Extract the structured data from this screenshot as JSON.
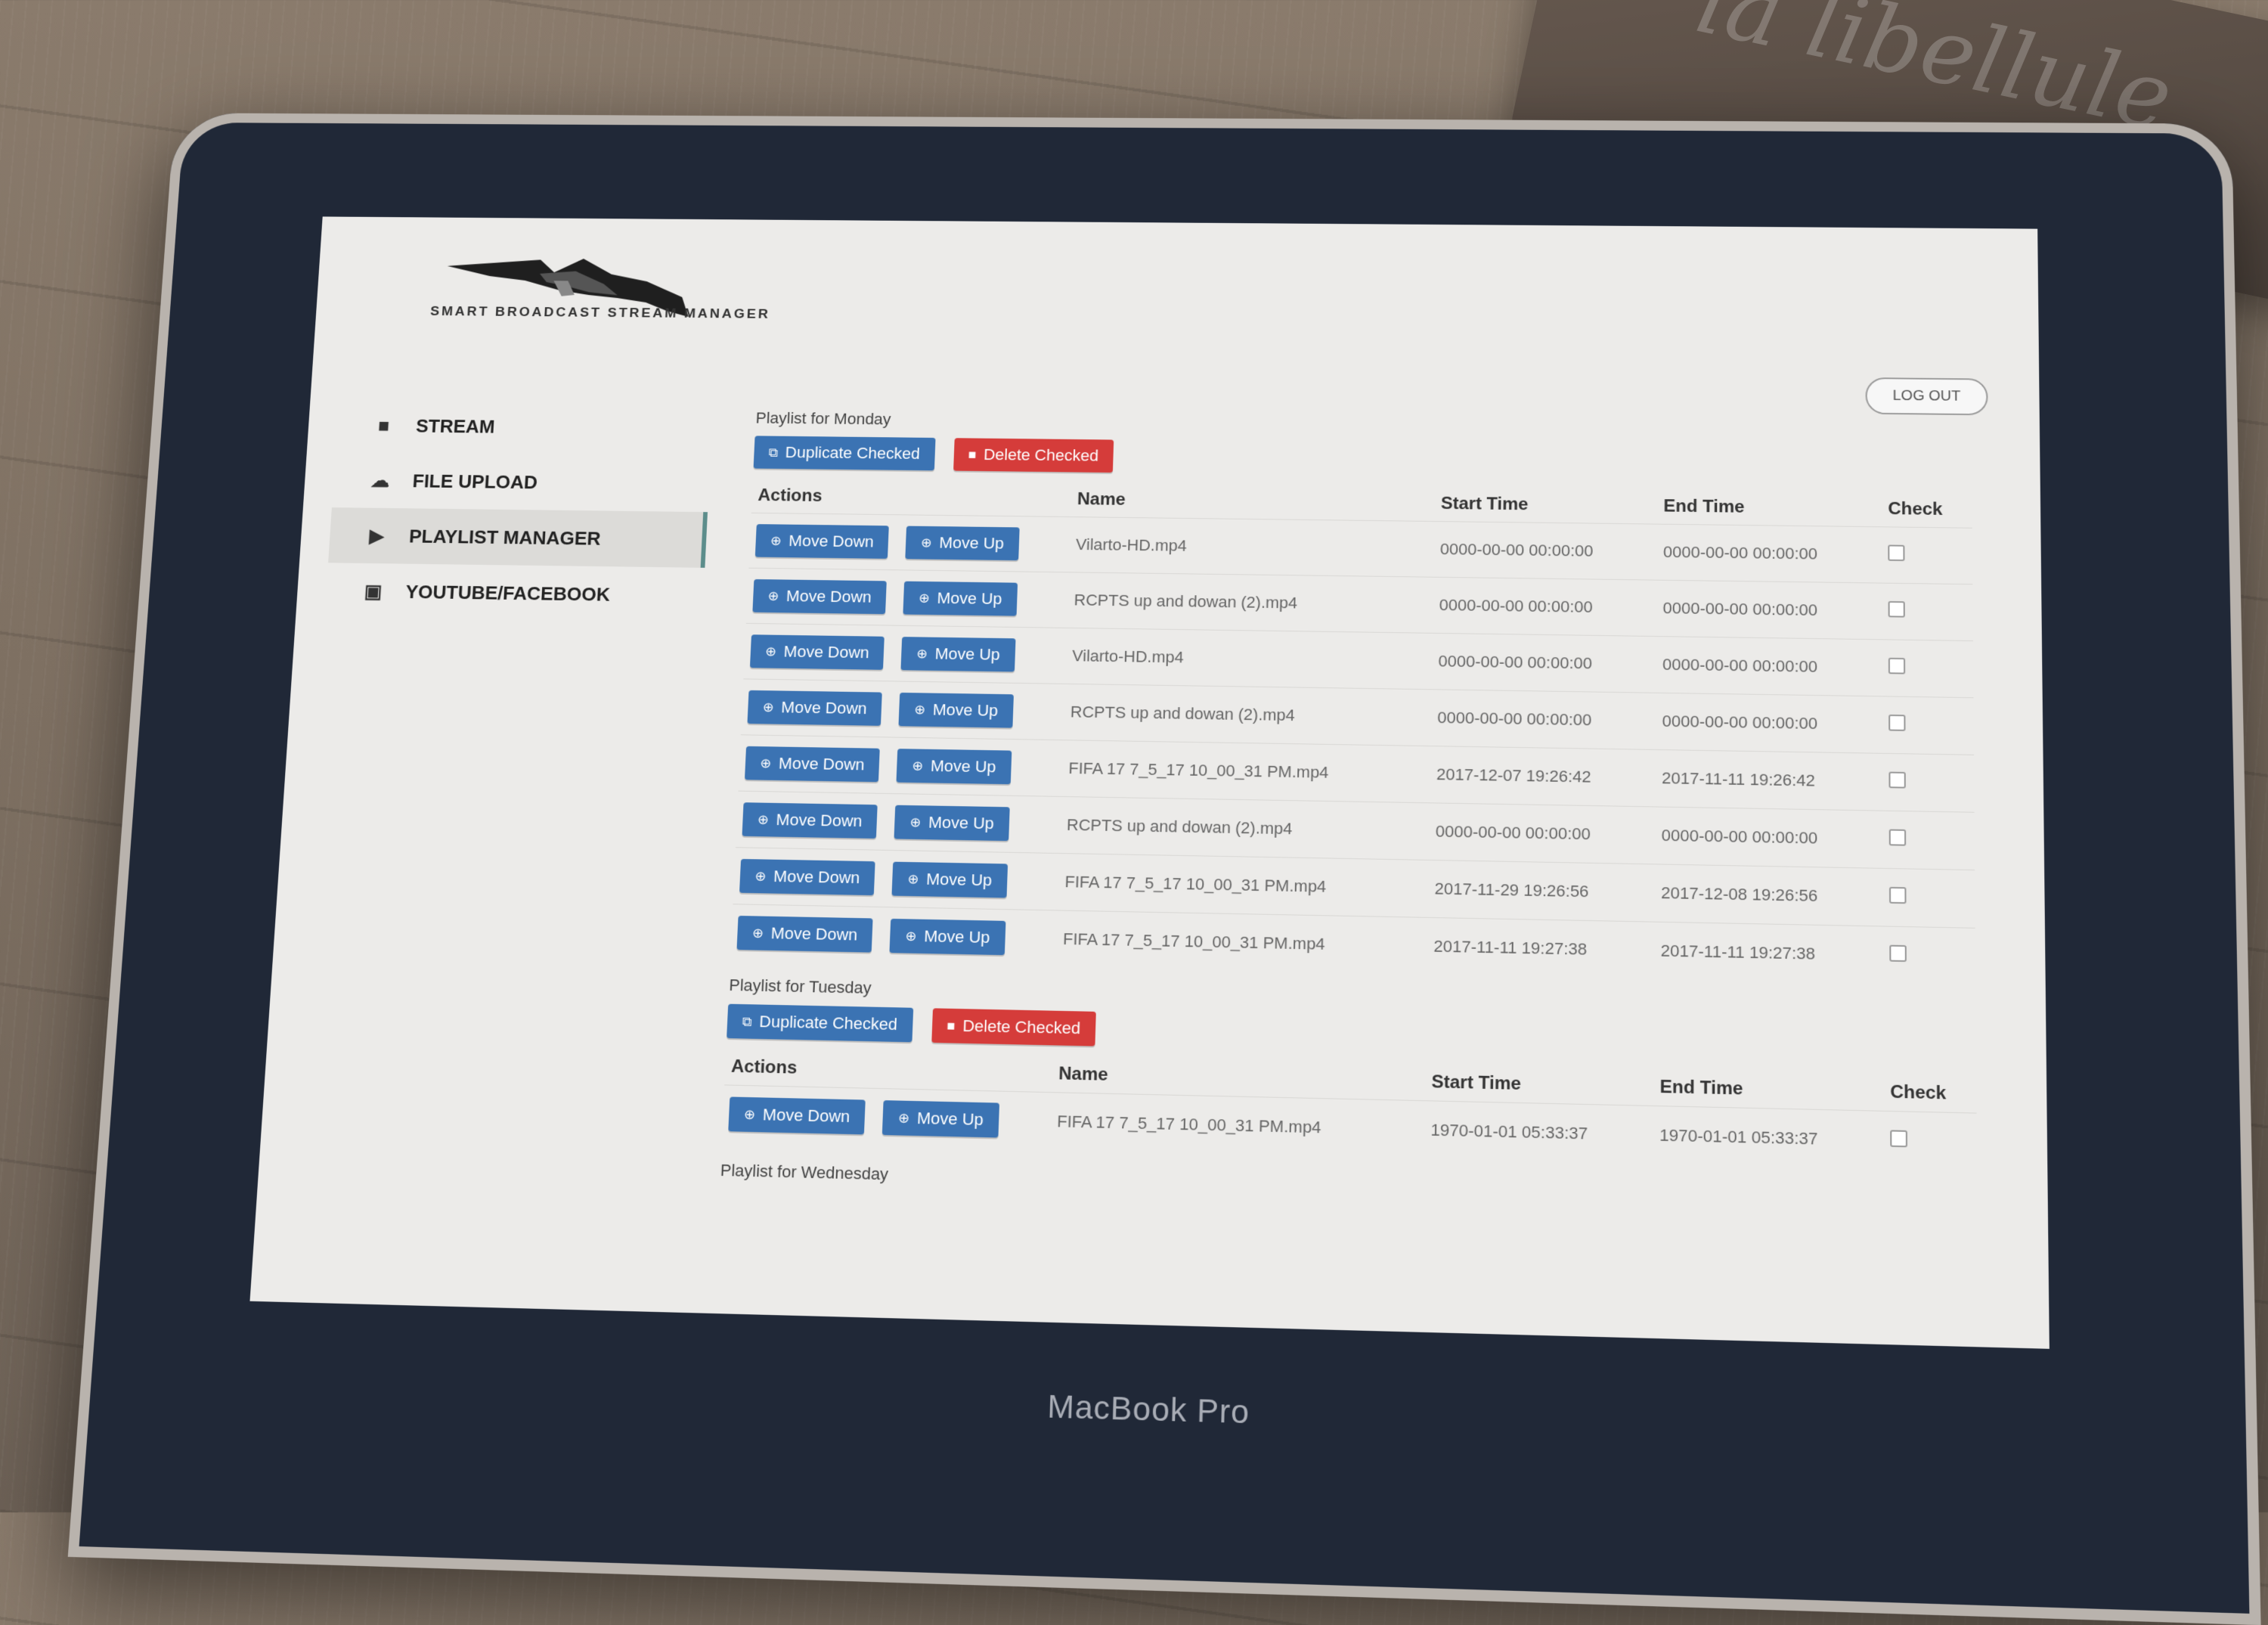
{
  "desk": {
    "engraving": "la libellule"
  },
  "laptop": {
    "brand": "MacBook Pro"
  },
  "app": {
    "logo_text": "SMART BROADCAST STREAM MANAGER",
    "logout_label": "LOG OUT"
  },
  "sidebar": {
    "items": [
      {
        "label": "STREAM",
        "icon": "video-camera-icon",
        "glyph": "■"
      },
      {
        "label": "FILE UPLOAD",
        "icon": "cloud-upload-icon",
        "glyph": "☁"
      },
      {
        "label": "PLAYLIST MANAGER",
        "icon": "play-icon",
        "glyph": "▶",
        "active": true
      },
      {
        "label": "YOUTUBE/FACEBOOK",
        "icon": "youtube-icon",
        "glyph": "▣"
      }
    ]
  },
  "labels": {
    "duplicate_checked": "Duplicate Checked",
    "delete_checked": "Delete Checked",
    "move_down": "Move Down",
    "move_up": "Move Up"
  },
  "columns": {
    "actions": "Actions",
    "name": "Name",
    "start_time": "Start Time",
    "end_time": "End Time",
    "check": "Check"
  },
  "playlists": {
    "monday": {
      "title": "Playlist for Monday",
      "rows": [
        {
          "name": "Vilarto-HD.mp4",
          "start": "0000-00-00 00:00:00",
          "end": "0000-00-00 00:00:00"
        },
        {
          "name": "RCPTS up and dowan (2).mp4",
          "start": "0000-00-00 00:00:00",
          "end": "0000-00-00 00:00:00"
        },
        {
          "name": "Vilarto-HD.mp4",
          "start": "0000-00-00 00:00:00",
          "end": "0000-00-00 00:00:00"
        },
        {
          "name": "RCPTS up and dowan (2).mp4",
          "start": "0000-00-00 00:00:00",
          "end": "0000-00-00 00:00:00"
        },
        {
          "name": "FIFA 17 7_5_17 10_00_31 PM.mp4",
          "start": "2017-12-07 19:26:42",
          "end": "2017-11-11 19:26:42"
        },
        {
          "name": "RCPTS up and dowan (2).mp4",
          "start": "0000-00-00 00:00:00",
          "end": "0000-00-00 00:00:00"
        },
        {
          "name": "FIFA 17 7_5_17 10_00_31 PM.mp4",
          "start": "2017-11-29 19:26:56",
          "end": "2017-12-08 19:26:56"
        },
        {
          "name": "FIFA 17 7_5_17 10_00_31 PM.mp4",
          "start": "2017-11-11 19:27:38",
          "end": "2017-11-11 19:27:38"
        }
      ]
    },
    "tuesday": {
      "title": "Playlist for Tuesday",
      "rows": [
        {
          "name": "FIFA 17 7_5_17 10_00_31 PM.mp4",
          "start": "1970-01-01 05:33:37",
          "end": "1970-01-01 05:33:37"
        }
      ]
    },
    "wednesday": {
      "title": "Playlist for Wednesday"
    }
  }
}
